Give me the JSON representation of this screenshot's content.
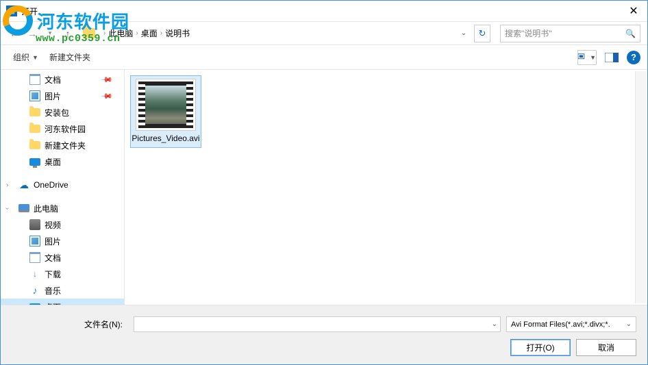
{
  "title": "打开",
  "watermark": {
    "brand": "河东软件园",
    "url": "www.pc0359.cn"
  },
  "breadcrumb": {
    "root": "此电脑",
    "mid": "桌面",
    "leaf": "说明书"
  },
  "search": {
    "placeholder": "搜索\"说明书\""
  },
  "toolbar": {
    "organize": "组织",
    "newfolder": "新建文件夹"
  },
  "sidebar": {
    "items": [
      {
        "label": "文档",
        "pin": true,
        "icon": "doc"
      },
      {
        "label": "图片",
        "pin": true,
        "icon": "img"
      },
      {
        "label": "安装包",
        "pin": false,
        "icon": "folder"
      },
      {
        "label": "河东软件园",
        "pin": false,
        "icon": "folder"
      },
      {
        "label": "新建文件夹",
        "pin": false,
        "icon": "folder"
      },
      {
        "label": "桌面",
        "pin": false,
        "icon": "desktop"
      }
    ],
    "onedrive": "OneDrive",
    "thispc": "此电脑",
    "thispc_items": [
      {
        "label": "视频",
        "icon": "video"
      },
      {
        "label": "图片",
        "icon": "img"
      },
      {
        "label": "文档",
        "icon": "doc"
      },
      {
        "label": "下载",
        "icon": "dl"
      },
      {
        "label": "音乐",
        "icon": "music"
      },
      {
        "label": "桌面",
        "icon": "desktop",
        "selected": true
      }
    ]
  },
  "files": [
    {
      "name": "Pictures_Video.avi"
    }
  ],
  "footer": {
    "filename_label": "文件名(N):",
    "filename_value": "",
    "filter": "Avi Format Files(*.avi;*.divx;*.",
    "open_btn": "打开(O)",
    "cancel_btn": "取消"
  }
}
